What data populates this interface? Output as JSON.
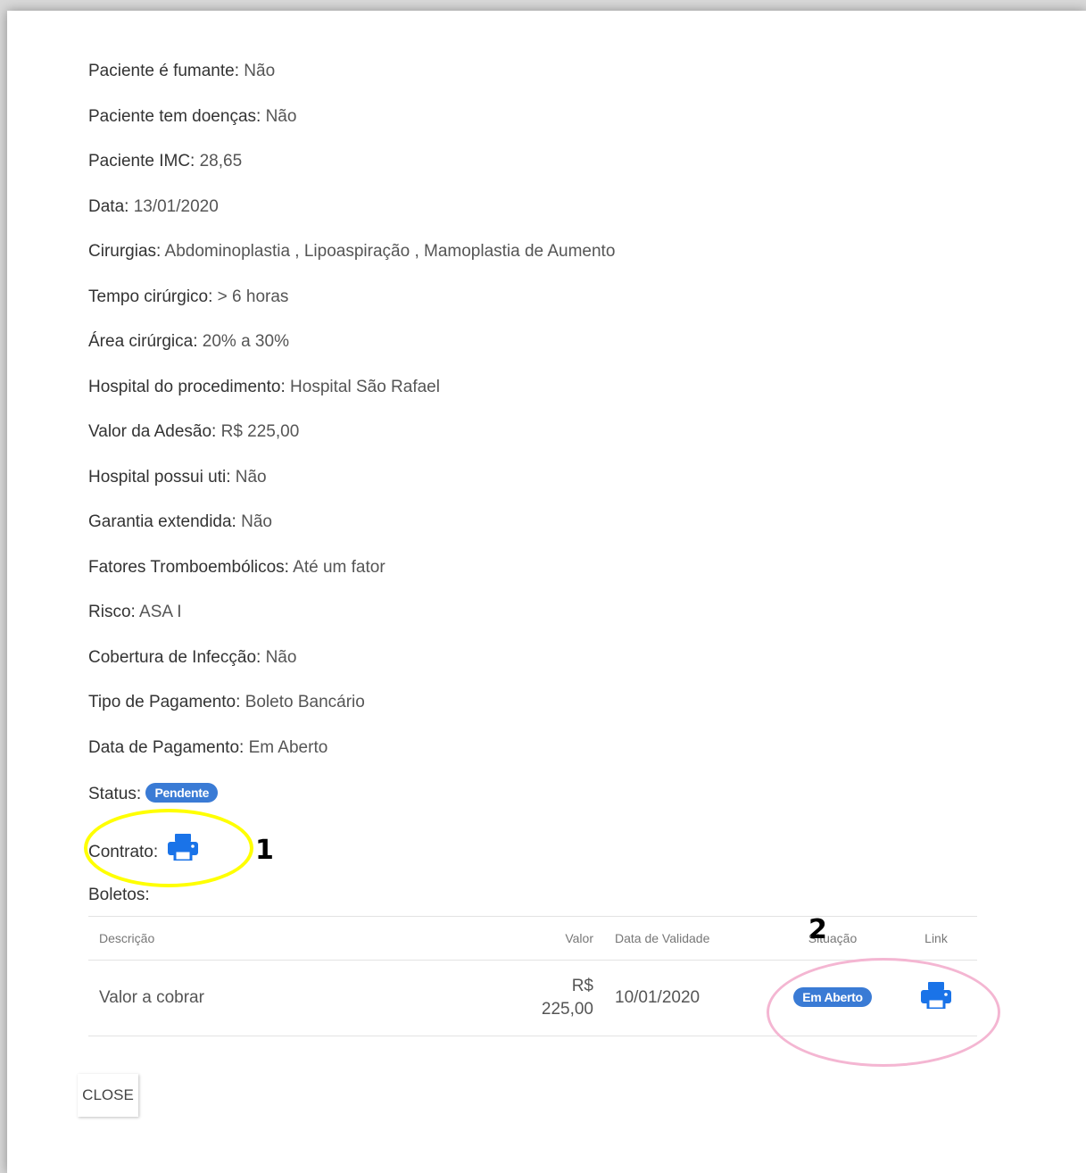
{
  "fields": [
    {
      "label": "Paciente é fumante:",
      "value": "Não"
    },
    {
      "label": "Paciente tem doenças:",
      "value": "Não"
    },
    {
      "label": "Paciente IMC:",
      "value": "28,65"
    },
    {
      "label": "Data:",
      "value": "13/01/2020"
    },
    {
      "label": "Cirurgias:",
      "value": "Abdominoplastia , Lipoaspiração , Mamoplastia de Aumento"
    },
    {
      "label": "Tempo cirúrgico:",
      "value": "> 6 horas"
    },
    {
      "label": "Área cirúrgica:",
      "value": "20% a 30%"
    },
    {
      "label": "Hospital do procedimento:",
      "value": "Hospital São Rafael"
    },
    {
      "label": "Valor da Adesão:",
      "value": "R$ 225,00"
    },
    {
      "label": "Hospital possui uti:",
      "value": "Não"
    },
    {
      "label": "Garantia extendida:",
      "value": "Não"
    },
    {
      "label": "Fatores Tromboembólicos:",
      "value": "Até um fator"
    },
    {
      "label": "Risco:",
      "value": "ASA I"
    },
    {
      "label": "Cobertura de Infecção:",
      "value": "Não"
    },
    {
      "label": "Tipo de Pagamento:",
      "value": "Boleto Bancário"
    },
    {
      "label": "Data de Pagamento:",
      "value": "Em Aberto"
    }
  ],
  "status": {
    "label": "Status:",
    "badge": "Pendente",
    "badge_color": "#3a7bd5"
  },
  "contrato": {
    "label": "Contrato:",
    "icon": "printer-icon"
  },
  "boletos": {
    "label": "Boletos:",
    "headers": {
      "descricao": "Descrição",
      "valor": "Valor",
      "data": "Data de Validade",
      "situacao": "Situação",
      "link": "Link"
    },
    "rows": [
      {
        "descricao": "Valor a cobrar",
        "valor_line1": "R$",
        "valor_line2": "225,00",
        "data": "10/01/2020",
        "situacao": "Em Aberto",
        "link_icon": "printer-icon"
      }
    ]
  },
  "annotations": {
    "marker1": "1",
    "marker2": "2",
    "ring1_color": "#ffff00",
    "ring2_color": "#f4b6d2"
  },
  "actions": {
    "close_label": "CLOSE"
  },
  "colors": {
    "accent": "#1a73e8",
    "badge": "#3a7bd5"
  }
}
